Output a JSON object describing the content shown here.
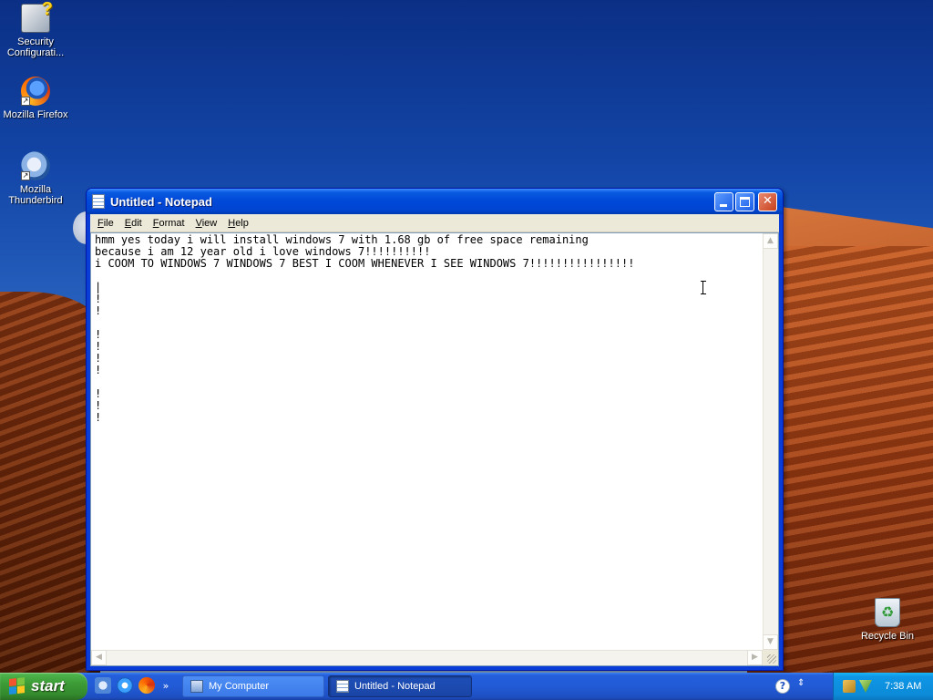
{
  "desktop": {
    "icons": [
      {
        "label_line1": "Security",
        "label_line2": "Configurati..."
      },
      {
        "label_line1": "Mozilla Firefox",
        "label_line2": ""
      },
      {
        "label_line1": "Mozilla",
        "label_line2": "Thunderbird"
      },
      {
        "label_line1": "Recycle Bin",
        "label_line2": ""
      }
    ]
  },
  "window": {
    "title": "Untitled - Notepad",
    "buttons": {
      "minimize_icon": "minimize-icon",
      "maximize_icon": "maximize-icon",
      "close_icon": "close-icon"
    }
  },
  "menubar": {
    "items": [
      "File",
      "Edit",
      "Format",
      "View",
      "Help"
    ]
  },
  "editor": {
    "lines": [
      "hmm yes today i will install windows 7 with 1.68 gb of free space remaining",
      "because i am 12 year old i love windows 7!!!!!!!!!!",
      "i COOM TO WINDOWS 7 WINDOWS 7 BEST I COOM WHENEVER I SEE WINDOWS 7!!!!!!!!!!!!!!!!",
      "",
      "|",
      "!",
      "!",
      "",
      "!",
      "!",
      "!",
      "!",
      "",
      "!",
      "!",
      "!"
    ]
  },
  "taskbar": {
    "start_label": "start",
    "quicklaunch_more": "»",
    "tasks": [
      {
        "label": "My Computer"
      },
      {
        "label": "Untitled - Notepad"
      }
    ],
    "help_glyph": "?",
    "clock": "7:38 AM"
  },
  "colors": {
    "title_bar": "#0048d8",
    "taskbar": "#225bd6",
    "start_button": "#3d9b36",
    "tray": "#0c8bd8"
  }
}
